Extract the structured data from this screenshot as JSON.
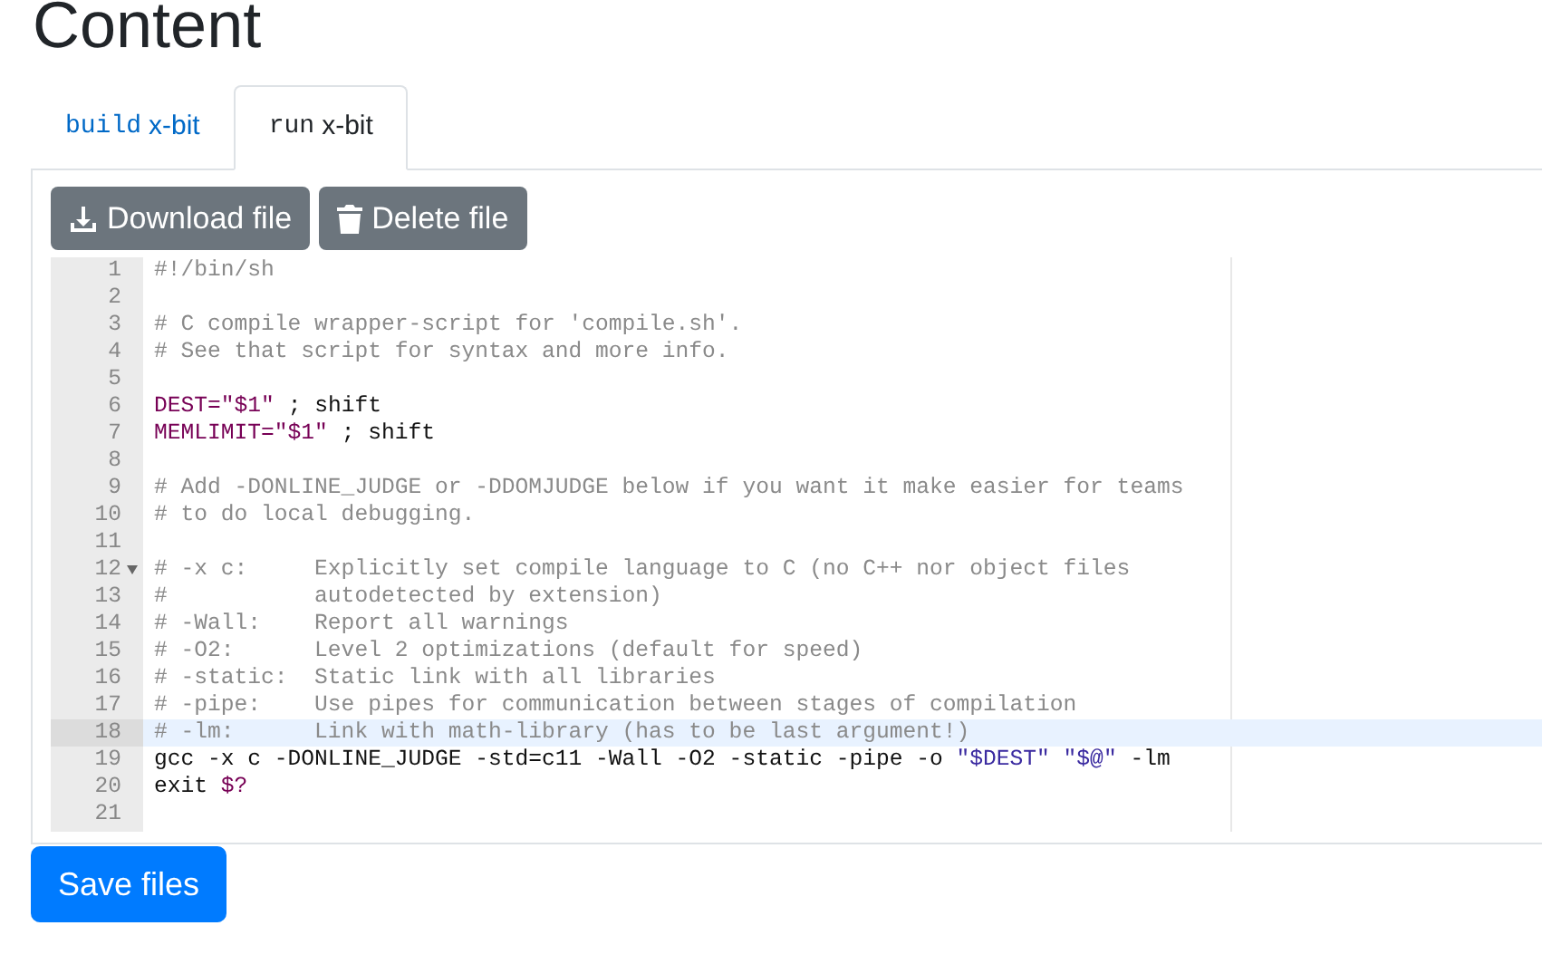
{
  "page_title": "Content",
  "tabs": [
    {
      "name": "build",
      "suffix": "x-bit",
      "selected": false
    },
    {
      "name": "run",
      "suffix": "x-bit",
      "selected": true
    }
  ],
  "toolbar": [
    {
      "label": "Download file",
      "kind": "download"
    },
    {
      "label": "Delete file",
      "kind": "delete"
    }
  ],
  "editor": {
    "lines": [
      {
        "number": "1",
        "segments": [
          {
            "text": "#!/bin/sh",
            "kind": "comment"
          }
        ]
      },
      {
        "number": "2"
      },
      {
        "number": "3",
        "segments": [
          {
            "text": "# C compile wrapper-script for 'compile.sh'.",
            "kind": "comment"
          }
        ]
      },
      {
        "number": "4",
        "segments": [
          {
            "text": "# See that script for syntax and more info.",
            "kind": "comment"
          }
        ]
      },
      {
        "number": "5"
      },
      {
        "number": "6",
        "segments": [
          {
            "text": "DEST=",
            "kind": "variable"
          },
          {
            "text": "\"$1\"",
            "kind": "variable"
          },
          {
            "text": " ; shift",
            "kind": "plain"
          }
        ]
      },
      {
        "number": "7",
        "segments": [
          {
            "text": "MEMLIMIT=",
            "kind": "variable"
          },
          {
            "text": "\"$1\"",
            "kind": "variable"
          },
          {
            "text": " ; shift",
            "kind": "plain"
          }
        ]
      },
      {
        "number": "8"
      },
      {
        "number": "9",
        "segments": [
          {
            "text": "# Add -DONLINE_JUDGE or -DDOMJUDGE below if you want it make easier for teams",
            "kind": "comment"
          }
        ]
      },
      {
        "number": "10",
        "segments": [
          {
            "text": "# to do local debugging.",
            "kind": "comment"
          }
        ]
      },
      {
        "number": "11"
      },
      {
        "number": "12",
        "fold": true,
        "segments": [
          {
            "text": "# -x c:     Explicitly set compile language to C (no C++ nor object files",
            "kind": "comment"
          }
        ]
      },
      {
        "number": "13",
        "segments": [
          {
            "text": "#           autodetected by extension)",
            "kind": "comment"
          }
        ]
      },
      {
        "number": "14",
        "segments": [
          {
            "text": "# -Wall:    Report all warnings",
            "kind": "comment"
          }
        ]
      },
      {
        "number": "15",
        "segments": [
          {
            "text": "# -O2:      Level 2 optimizations (default for speed)",
            "kind": "comment"
          }
        ]
      },
      {
        "number": "16",
        "segments": [
          {
            "text": "# -static:  Static link with all libraries",
            "kind": "comment"
          }
        ]
      },
      {
        "number": "17",
        "segments": [
          {
            "text": "# -pipe:    Use pipes for communication between stages of compilation",
            "kind": "comment"
          }
        ]
      },
      {
        "number": "18",
        "active": true,
        "segments": [
          {
            "text": "# -lm:      Link with math-library (has to be last argument!)",
            "kind": "comment"
          }
        ]
      },
      {
        "number": "19",
        "segments": [
          {
            "text": "gcc -x c -DONLINE_JUDGE -std=c11 -Wall -O2 -static -pipe -o ",
            "kind": "plain"
          },
          {
            "text": "\"$DEST\" \"$@\"",
            "kind": "string"
          },
          {
            "text": " -lm",
            "kind": "plain"
          }
        ]
      },
      {
        "number": "20",
        "segments": [
          {
            "text": "exit ",
            "kind": "plain"
          },
          {
            "text": "$?",
            "kind": "variable"
          }
        ]
      },
      {
        "number": "21"
      }
    ]
  },
  "save_button": "Save files"
}
